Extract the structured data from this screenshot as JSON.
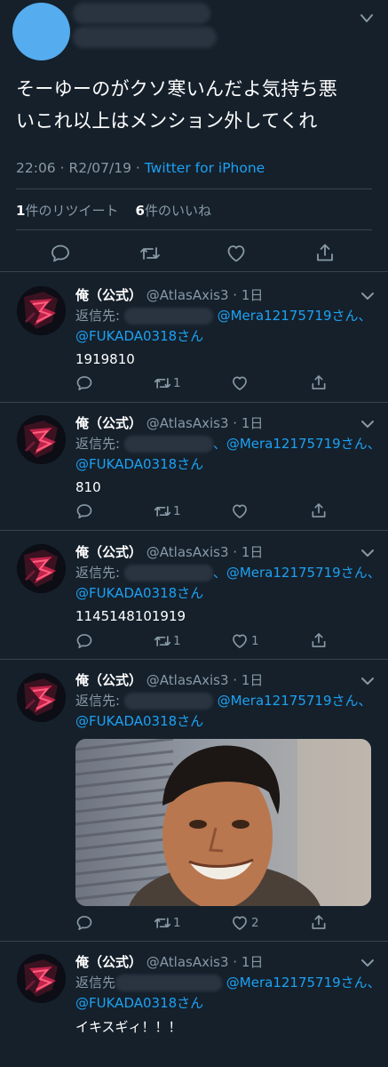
{
  "main_tweet": {
    "text_line1": "そーゆーのがクソ寒いんだよ気持ち悪",
    "text_line2": "いこれ以上はメンション外してくれ",
    "time": "22:06 · R2/07/19 · ",
    "source": "Twitter for iPhone",
    "retweet_count": "1",
    "retweet_label": "件のリツイート",
    "like_count": "6",
    "like_label": "件のいいね"
  },
  "colors": {
    "background": "#15202b",
    "accent": "#1da1f2",
    "secondary_text": "#8899a6",
    "divider": "#38444d"
  },
  "icons": {
    "reply": "speech-bubble-icon",
    "retweet": "retweet-arrows-icon",
    "like": "heart-icon",
    "share": "share-upload-icon",
    "menu": "chevron-down-icon"
  },
  "replies": [
    {
      "name": "俺（公式）",
      "handle": "@AtlasAxis3 · 1日",
      "reply_prefix": "返信先: ",
      "mention1": "@Mera12175719さん、",
      "mention2": "@FUKADA0318さん",
      "body": "1919810",
      "retweets": "1",
      "likes": ""
    },
    {
      "name": "俺（公式）",
      "handle": "@AtlasAxis3 · 1日",
      "reply_prefix": "返信先: ",
      "mention1": "、@Mera12175719さん、",
      "mention2": "@FUKADA0318さん",
      "body": "810",
      "retweets": "1",
      "likes": ""
    },
    {
      "name": "俺（公式）",
      "handle": "@AtlasAxis3 · 1日",
      "reply_prefix": "返信先: ",
      "mention1": "、@Mera12175719さん、",
      "mention2": "@FUKADA0318さん",
      "body": "1145148101919",
      "retweets": "1",
      "likes": "1"
    },
    {
      "name": "俺（公式）",
      "handle": "@AtlasAxis3 · 1日",
      "reply_prefix": "返信先: ",
      "mention1": "@Mera12175719さん、",
      "mention2": "@FUKADA0318さん",
      "body": "",
      "retweets": "1",
      "likes": "2"
    },
    {
      "name": "俺（公式）",
      "handle": "@AtlasAxis3 · 1日",
      "reply_prefix": "返信先",
      "mention1": "@Mera12175719さん、",
      "mention2": "@FUKADA0318さん",
      "body": "イキスギィ！！！",
      "retweets": "",
      "likes": ""
    }
  ]
}
